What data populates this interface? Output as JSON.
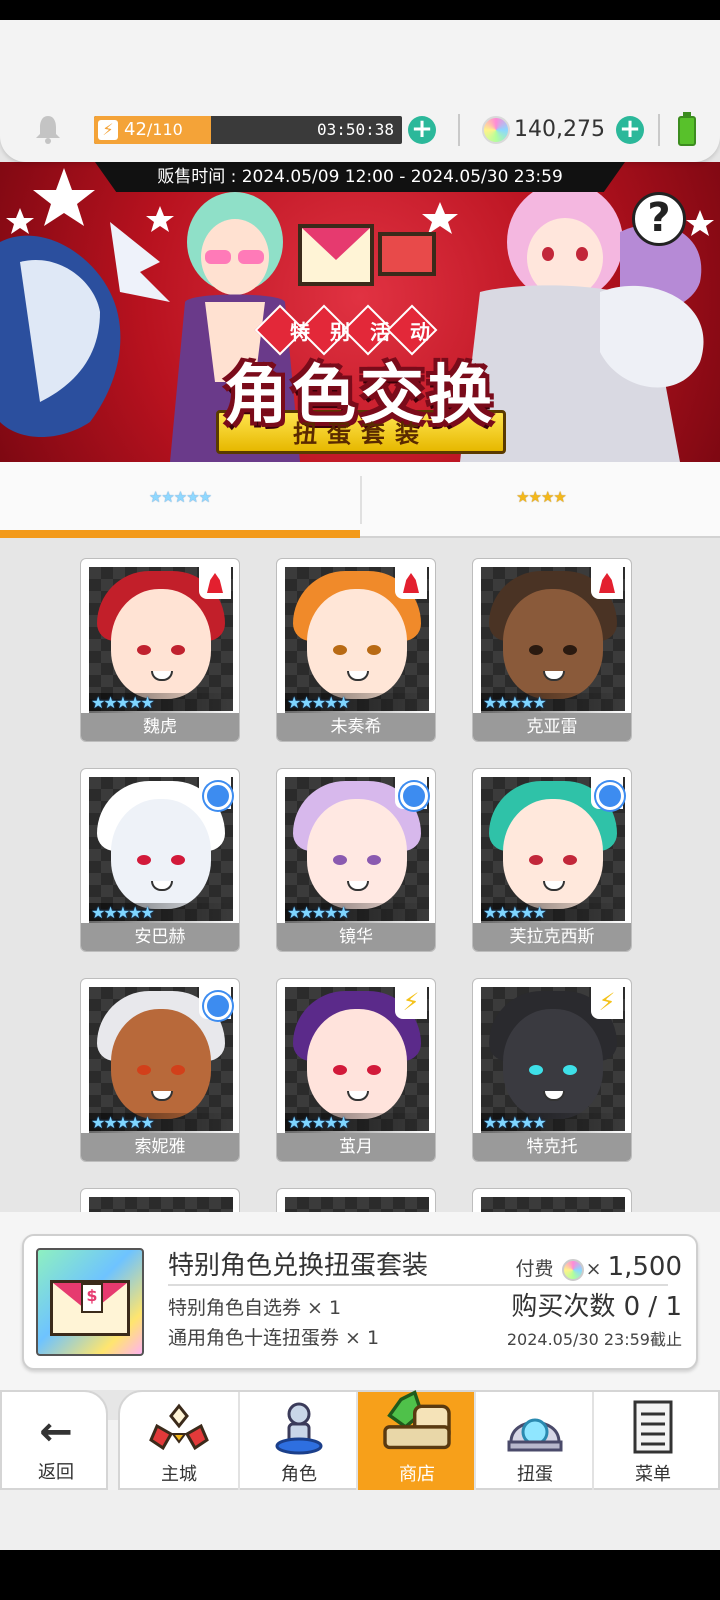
{
  "header": {
    "stamina_current": "42",
    "stamina_max": "/110",
    "stamina_progress": 0.38,
    "stamina_timer": "03:50:38",
    "gems": "140,275"
  },
  "banner": {
    "sale_period": "贩售时间 : 2024.05/09 12:00 - 2024.05/30 23:59",
    "event_label": "特别活动",
    "event_title": "角色交换",
    "event_subtitle": "扭蛋套装"
  },
  "tabs": [
    {
      "label": "★★★★★",
      "active": true
    },
    {
      "label": "★★★★",
      "active": false
    }
  ],
  "characters": [
    {
      "name": "魏虎",
      "rarity": "★★★★★",
      "element": "fire"
    },
    {
      "name": "未奏希",
      "rarity": "★★★★★",
      "element": "fire"
    },
    {
      "name": "克亚雷",
      "rarity": "★★★★★",
      "element": "fire"
    },
    {
      "name": "安巴赫",
      "rarity": "★★★★★",
      "element": "water"
    },
    {
      "name": "镜华",
      "rarity": "★★★★★",
      "element": "water"
    },
    {
      "name": "芙拉克西斯",
      "rarity": "★★★★★",
      "element": "water"
    },
    {
      "name": "索妮雅",
      "rarity": "★★★★★",
      "element": "water"
    },
    {
      "name": "茧月",
      "rarity": "★★★★★",
      "element": "light"
    },
    {
      "name": "特克托",
      "rarity": "★★★★★",
      "element": "light"
    }
  ],
  "purchase": {
    "title": "特别角色兑换扭蛋套装",
    "item1": "特别角色自选券 × 1",
    "item2": "通用角色十连扭蛋券 × 1",
    "pay_label": "付费",
    "pay_multiplier": "×",
    "pay_amount": "1,500",
    "purchase_count": "购买次数 0 / 1",
    "deadline": "2024.05/30 23:59截止"
  },
  "nav": {
    "back": "返回",
    "items": [
      "主城",
      "角色",
      "商店",
      "扭蛋",
      "菜单"
    ],
    "active": "商店"
  },
  "colors": {
    "accent_orange": "#f39a1a",
    "plus_green": "#2bb89a",
    "banner_red": "#b8121f"
  }
}
